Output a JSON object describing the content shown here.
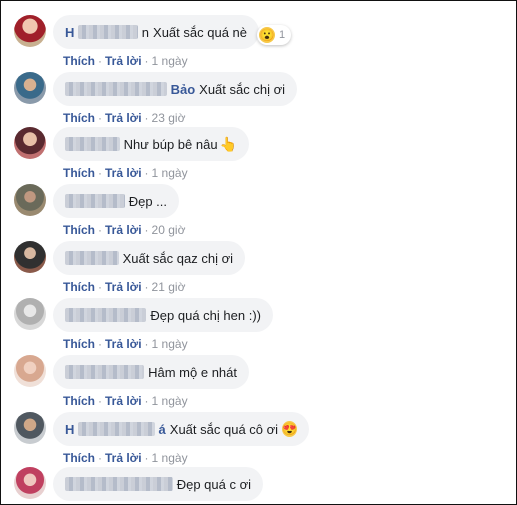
{
  "comments": [
    {
      "name_visible": "H",
      "name_tail": "n",
      "text": "Xuất sắc quá nè",
      "time": "1 ngày",
      "reaction": {
        "icon": "wow-emoji-icon",
        "count": "1"
      }
    },
    {
      "name_visible": "",
      "name_tail": "Bảo",
      "text": "Xuất sắc chị ơi",
      "time": "23 giờ"
    },
    {
      "name_visible": "",
      "name_tail": "",
      "text": "Như búp bê nâu",
      "emoji": "pointing-hand-emoji-icon",
      "time": "1 ngày"
    },
    {
      "name_visible": "",
      "name_tail": "",
      "text": "Đẹp ...",
      "time": "20 giờ"
    },
    {
      "name_visible": "",
      "name_tail": "",
      "text": "Xuất sắc qaz chị ơi",
      "time": "21 giờ"
    },
    {
      "name_visible": "",
      "name_tail": "",
      "text": "Đẹp quá chị hen :))",
      "time": "1 ngày"
    },
    {
      "name_visible": "",
      "name_tail": "",
      "text": "Hâm mộ e nhát",
      "time": "1 ngày"
    },
    {
      "name_visible": "H",
      "name_tail": "á",
      "text": "Xuất sắc quá cô ơi",
      "emoji": "heart-eyes-emoji-icon",
      "time": "1 ngày"
    },
    {
      "name_visible": "",
      "name_tail": "",
      "text": "Đẹp quá c ơi",
      "time": "1 ngày"
    }
  ],
  "actions": {
    "like": "Thích",
    "reply": "Trả lời",
    "separator": "·"
  },
  "colors": {
    "bubble": "#f2f3f5",
    "link": "#385898",
    "meta": "#90949c"
  }
}
